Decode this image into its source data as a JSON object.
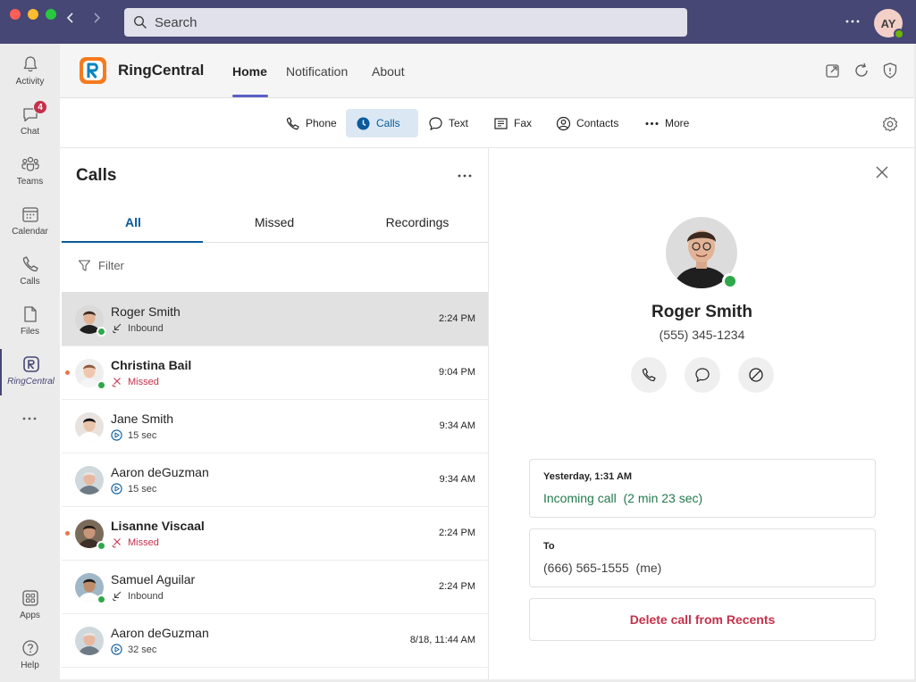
{
  "titlebar": {
    "search_placeholder": "Search",
    "user_initials": "AY"
  },
  "rail": {
    "items": [
      {
        "label": "Activity",
        "icon": "bell-icon"
      },
      {
        "label": "Chat",
        "icon": "chat-icon",
        "badge": "4"
      },
      {
        "label": "Teams",
        "icon": "teams-icon"
      },
      {
        "label": "Calendar",
        "icon": "calendar-icon"
      },
      {
        "label": "Calls",
        "icon": "phone-icon"
      },
      {
        "label": "Files",
        "icon": "file-icon"
      },
      {
        "label": "RingCentral",
        "icon": "ringcentral-icon",
        "active": true
      },
      {
        "label": "Apps",
        "icon": "apps-icon"
      },
      {
        "label": "Help",
        "icon": "help-icon"
      }
    ]
  },
  "app": {
    "name": "RingCentral",
    "tabs": [
      "Home",
      "Notification",
      "About"
    ],
    "active_tab": "Home"
  },
  "subnav": {
    "items": [
      {
        "label": "Phone",
        "icon": "phone-icon"
      },
      {
        "label": "Calls",
        "icon": "clock-icon",
        "active": true
      },
      {
        "label": "Text",
        "icon": "message-icon"
      },
      {
        "label": "Fax",
        "icon": "fax-icon"
      },
      {
        "label": "Contacts",
        "icon": "contact-icon"
      },
      {
        "label": "More",
        "icon": "more-icon"
      }
    ]
  },
  "calls": {
    "title": "Calls",
    "tabs": [
      "All",
      "Missed",
      "Recordings"
    ],
    "active_tab": "All",
    "filter_placeholder": "Filter",
    "rows": [
      {
        "name": "Roger Smith",
        "status": "Inbound",
        "type": "inbound",
        "time": "2:24 PM",
        "unread": false,
        "selected": true,
        "presence": true
      },
      {
        "name": "Christina Bail",
        "status": "Missed",
        "type": "missed",
        "time": "9:04 PM",
        "unread": true,
        "selected": false,
        "presence": true
      },
      {
        "name": "Jane Smith",
        "status": "15 sec",
        "type": "recording",
        "time": "9:34 AM",
        "unread": false,
        "selected": false,
        "presence": false
      },
      {
        "name": "Aaron deGuzman",
        "status": "15 sec",
        "type": "recording",
        "time": "9:34 AM",
        "unread": false,
        "selected": false,
        "presence": false
      },
      {
        "name": "Lisanne Viscaal",
        "status": "Missed",
        "type": "missed",
        "time": "2:24 PM",
        "unread": true,
        "selected": false,
        "presence": true
      },
      {
        "name": "Samuel Aguilar",
        "status": "Inbound",
        "type": "inbound",
        "time": "2:24 PM",
        "unread": false,
        "selected": false,
        "presence": true
      },
      {
        "name": "Aaron deGuzman",
        "status": "32 sec",
        "type": "recording",
        "time": "8/18, 11:44 AM",
        "unread": false,
        "selected": false,
        "presence": false
      }
    ]
  },
  "detail": {
    "name": "Roger Smith",
    "phone": "(555) 345-1234",
    "call_time": "Yesterday, 1:31 AM",
    "call_desc": "Incoming call",
    "call_duration": "(2 min 23 sec)",
    "to_label": "To",
    "to_number": "(666) 565-1555",
    "to_suffix": "(me)",
    "delete_label": "Delete call from Recents"
  },
  "colors": {
    "titlebar": "#464775",
    "accent": "#0a5a9c",
    "missed": "#c4314b",
    "presence": "#2ea84a",
    "incoming": "#237b4b"
  }
}
